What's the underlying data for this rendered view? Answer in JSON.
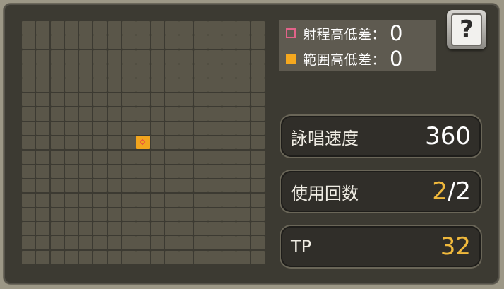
{
  "legend": {
    "range_label": "射程高低差：",
    "range_value": "0",
    "area_label": "範囲高低差：",
    "area_value": "0"
  },
  "help": {
    "glyph": "?"
  },
  "stats": {
    "cast_speed": {
      "label": "詠唱速度",
      "value": "360"
    },
    "uses": {
      "label": "使用回数",
      "current": "2",
      "separator": "/",
      "max": "2"
    },
    "tp": {
      "label": "TP",
      "value": "32"
    }
  },
  "grid": {
    "columns": 17,
    "rows": 17,
    "target_cell": {
      "column": 9,
      "row": 9
    }
  },
  "colors": {
    "cell": "#5a5649",
    "target_cell": "#f2a51e",
    "range_marker": "#e2638a",
    "area_marker": "#f5a81f",
    "highlight_value": "#f0b93c"
  }
}
